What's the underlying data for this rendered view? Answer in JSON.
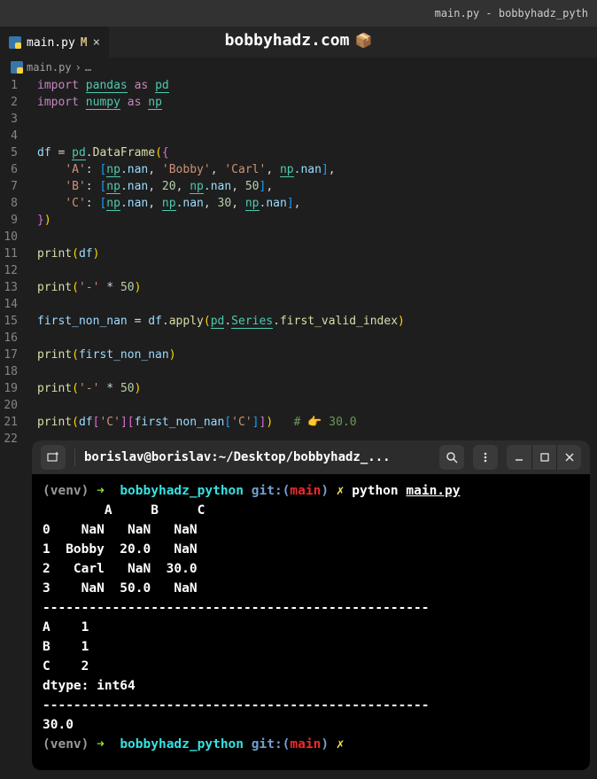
{
  "window": {
    "title": "main.py - bobbyhadz_pyth"
  },
  "watermark": {
    "text": "bobbyhadz.com",
    "box": "📦"
  },
  "tab": {
    "filename": "main.py",
    "modified_indicator": "M",
    "close": "×"
  },
  "breadcrumb": {
    "filename": "main.py",
    "separator": "›",
    "more": "…"
  },
  "line_numbers": [
    "1",
    "2",
    "3",
    "4",
    "5",
    "6",
    "7",
    "8",
    "9",
    "10",
    "11",
    "12",
    "13",
    "14",
    "15",
    "16",
    "17",
    "18",
    "19",
    "20",
    "21",
    "22"
  ],
  "code": {
    "l1": {
      "import": "import",
      "pandas": "pandas",
      "as": "as",
      "pd": "pd"
    },
    "l2": {
      "import": "import",
      "numpy": "numpy",
      "as": "as",
      "np": "np"
    },
    "l5": {
      "df": "df",
      "eq": "=",
      "pd": "pd",
      "dot": ".",
      "DataFrame": "DataFrame",
      "open": "(",
      "brace": "{"
    },
    "l6": {
      "indent": "    ",
      "key": "'A'",
      "colon": ":",
      "open": "[",
      "np1": "np",
      "nan1": ".nan",
      "c1": ",",
      "s1": "'Bobby'",
      "c2": ",",
      "s2": "'Carl'",
      "c3": ",",
      "np2": "np",
      "nan2": ".nan",
      "close": "]",
      "c4": ","
    },
    "l7": {
      "indent": "    ",
      "key": "'B'",
      "colon": ":",
      "open": "[",
      "np1": "np",
      "nan1": ".nan",
      "c1": ",",
      "n1": "20",
      "c2": ",",
      "np2": "np",
      "nan2": ".nan",
      "c3": ",",
      "n2": "50",
      "close": "]",
      "c4": ","
    },
    "l8": {
      "indent": "    ",
      "key": "'C'",
      "colon": ":",
      "open": "[",
      "np1": "np",
      "nan1": ".nan",
      "c1": ",",
      "np2": "np",
      "nan2": ".nan",
      "c2": ",",
      "n1": "30",
      "c3": ",",
      "np3": "np",
      "nan3": ".nan",
      "close": "]",
      "c4": ","
    },
    "l9": {
      "brace": "}",
      "close": ")"
    },
    "l11": {
      "print": "print",
      "open": "(",
      "df": "df",
      "close": ")"
    },
    "l13": {
      "print": "print",
      "open": "(",
      "s": "'-'",
      "mul": "*",
      "n": "50",
      "close": ")"
    },
    "l15": {
      "var": "first_non_nan",
      "eq": "=",
      "df": "df",
      "dot1": ".",
      "apply": "apply",
      "open": "(",
      "pd": "pd",
      "dot2": ".",
      "Series": "Series",
      "dot3": ".",
      "fvi": "first_valid_index",
      "close": ")"
    },
    "l17": {
      "print": "print",
      "open": "(",
      "var": "first_non_nan",
      "close": ")"
    },
    "l19": {
      "print": "print",
      "open": "(",
      "s": "'-'",
      "mul": "*",
      "n": "50",
      "close": ")"
    },
    "l21": {
      "print": "print",
      "open": "(",
      "df": "df",
      "b1": "[",
      "s1": "'C'",
      "b2": "]",
      "b3": "[",
      "var": "first_non_nan",
      "b4": "[",
      "s2": "'C'",
      "b5": "]",
      "b6": "]",
      "close": ")",
      "cmt": "# 👉 30.0"
    }
  },
  "terminal": {
    "title": "borislav@borislav:~/Desktop/bobbyhadz_...",
    "prompt1": {
      "venv": "(venv)",
      "arrow": "➜",
      "dir": "bobbyhadz_python",
      "git": "git:(",
      "branch": "main",
      "gitclose": ")",
      "x": "✗",
      "cmd": "python",
      "file": "main.py"
    },
    "output_header": "        A     B     C",
    "output_rows": [
      "0    NaN   NaN   NaN",
      "1  Bobby  20.0   NaN",
      "2   Carl   NaN  30.0",
      "3    NaN  50.0   NaN"
    ],
    "sep": "--------------------------------------------------",
    "series": [
      "A    1",
      "B    1",
      "C    2",
      "dtype: int64"
    ],
    "result": "30.0",
    "prompt2": {
      "venv": "(venv)",
      "arrow": "➜",
      "dir": "bobbyhadz_python",
      "git": "git:(",
      "branch": "main",
      "gitclose": ")",
      "x": "✗"
    }
  }
}
